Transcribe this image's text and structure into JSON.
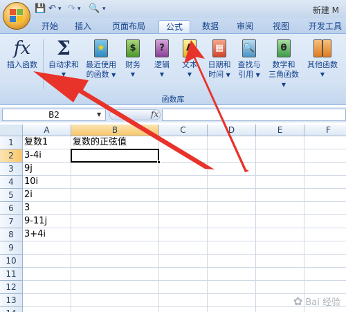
{
  "window": {
    "title": "新建 M"
  },
  "quick_access": {
    "save_icon": "save-icon",
    "undo_icon": "undo-icon",
    "redo_icon": "redo-icon",
    "print_preview_icon": "print-preview-icon"
  },
  "tabs": [
    {
      "label": "开始",
      "active": false
    },
    {
      "label": "插入",
      "active": false
    },
    {
      "label": "页面布局",
      "active": false
    },
    {
      "label": "公式",
      "active": true
    },
    {
      "label": "数据",
      "active": false
    },
    {
      "label": "审阅",
      "active": false
    },
    {
      "label": "视图",
      "active": false
    },
    {
      "label": "开发工具",
      "active": false
    }
  ],
  "ribbon": {
    "insert_function": {
      "icon_text": "fx",
      "label": "插入函数"
    },
    "autosum": {
      "icon_text": "Σ",
      "label": "自动求和"
    },
    "recent": {
      "label_line1": "最近使用",
      "label_line2": "的函数"
    },
    "financial": {
      "label": "财务"
    },
    "logical": {
      "icon_text": "?",
      "label": "逻辑"
    },
    "text": {
      "icon_text": "A",
      "label": "文本"
    },
    "datetime": {
      "label_line1": "日期和",
      "label_line2": "时间"
    },
    "lookup": {
      "label_line1": "查找与",
      "label_line2": "引用"
    },
    "math": {
      "icon_text": "θ",
      "label_line1": "数学和",
      "label_line2": "三角函数"
    },
    "more": {
      "label": "其他函数"
    },
    "group_label": "函数库"
  },
  "formula_bar": {
    "name_box": "B2",
    "fx_label": "fx",
    "formula": ""
  },
  "sheet": {
    "columns": [
      "A",
      "B",
      "C",
      "D",
      "E",
      "F"
    ],
    "rows": [
      "1",
      "2",
      "3",
      "4",
      "5",
      "6",
      "7",
      "8",
      "9",
      "10",
      "11",
      "12",
      "13",
      "14"
    ],
    "selected_cell": "B2",
    "cells": {
      "A1": "复数1",
      "B1": "复数的正弦值",
      "A2": "3-4i",
      "A3": "9j",
      "A4": "10i",
      "A5": "2i",
      "A6": "3",
      "A7": "9-11j",
      "A8": "3+4i"
    }
  },
  "annotation_color": "#e8332a",
  "watermark": {
    "text": "Bai 经验"
  }
}
